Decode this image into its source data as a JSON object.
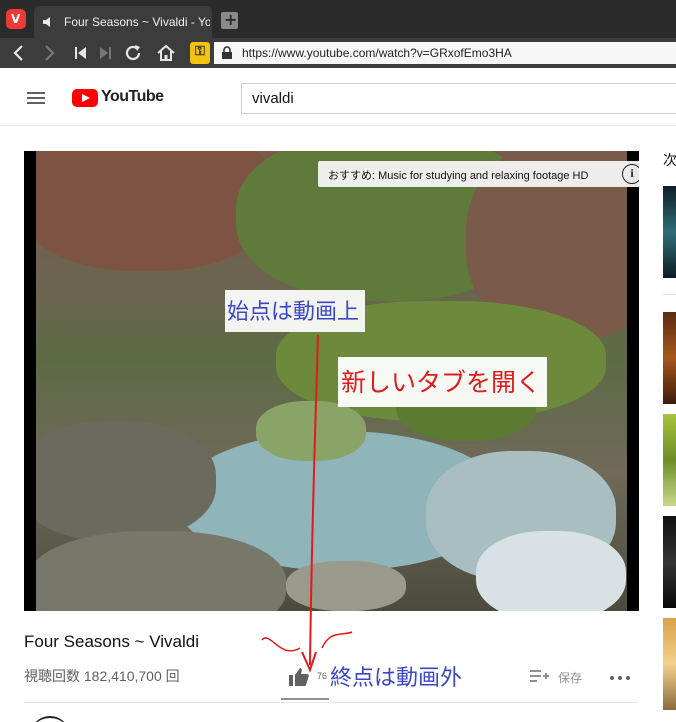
{
  "browser": {
    "tab_title": "Four Seasons ~ Vivaldi - YouTube",
    "url": "https://www.youtube.com/watch?v=GRxofEmo3HA",
    "logo_letter": "V"
  },
  "youtube": {
    "logo_text": "YouTube",
    "search_value": "vivaldi"
  },
  "player": {
    "recommend_chip": "おすすめ: Music for studying and relaxing footage HD",
    "info_icon_glyph": "i"
  },
  "annotations": {
    "start": "始点は動画上",
    "action": "新しいタブを開く",
    "end": "終点は動画外"
  },
  "video": {
    "title": "Four Seasons ~ Vivaldi",
    "views": "視聴回数 182,410,700 回",
    "like_count": "76",
    "save_label": "保存"
  },
  "sidebar": {
    "label": "次"
  },
  "colors": {
    "tabbar": "#2b2b2b",
    "vivaldi_red": "#ef3939",
    "youtube_red": "#ff0000",
    "annotation_blue": "#3b47c4",
    "annotation_red": "#e01b1b",
    "key_yellow": "#f2c40f"
  }
}
